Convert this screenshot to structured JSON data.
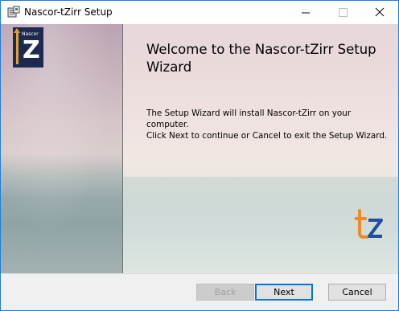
{
  "window": {
    "title": "Nascor-tZirr Setup"
  },
  "logo": {
    "brand": "Nascor",
    "letter": "Z"
  },
  "wizard": {
    "heading": "Welcome to the Nascor-tZirr Setup Wizard",
    "body_line1": "The Setup Wizard will install Nascor-tZirr on your computer.",
    "body_line2": "Click Next to continue or Cancel to exit the Setup Wizard."
  },
  "buttons": {
    "back": "Back",
    "next": "Next",
    "cancel": "Cancel"
  },
  "colors": {
    "accent": "#0078d7",
    "logo_navy": "#1b2a4e",
    "logo_orange": "#e0a030",
    "tz_orange": "#f08a24",
    "tz_blue": "#1f4e9c"
  }
}
